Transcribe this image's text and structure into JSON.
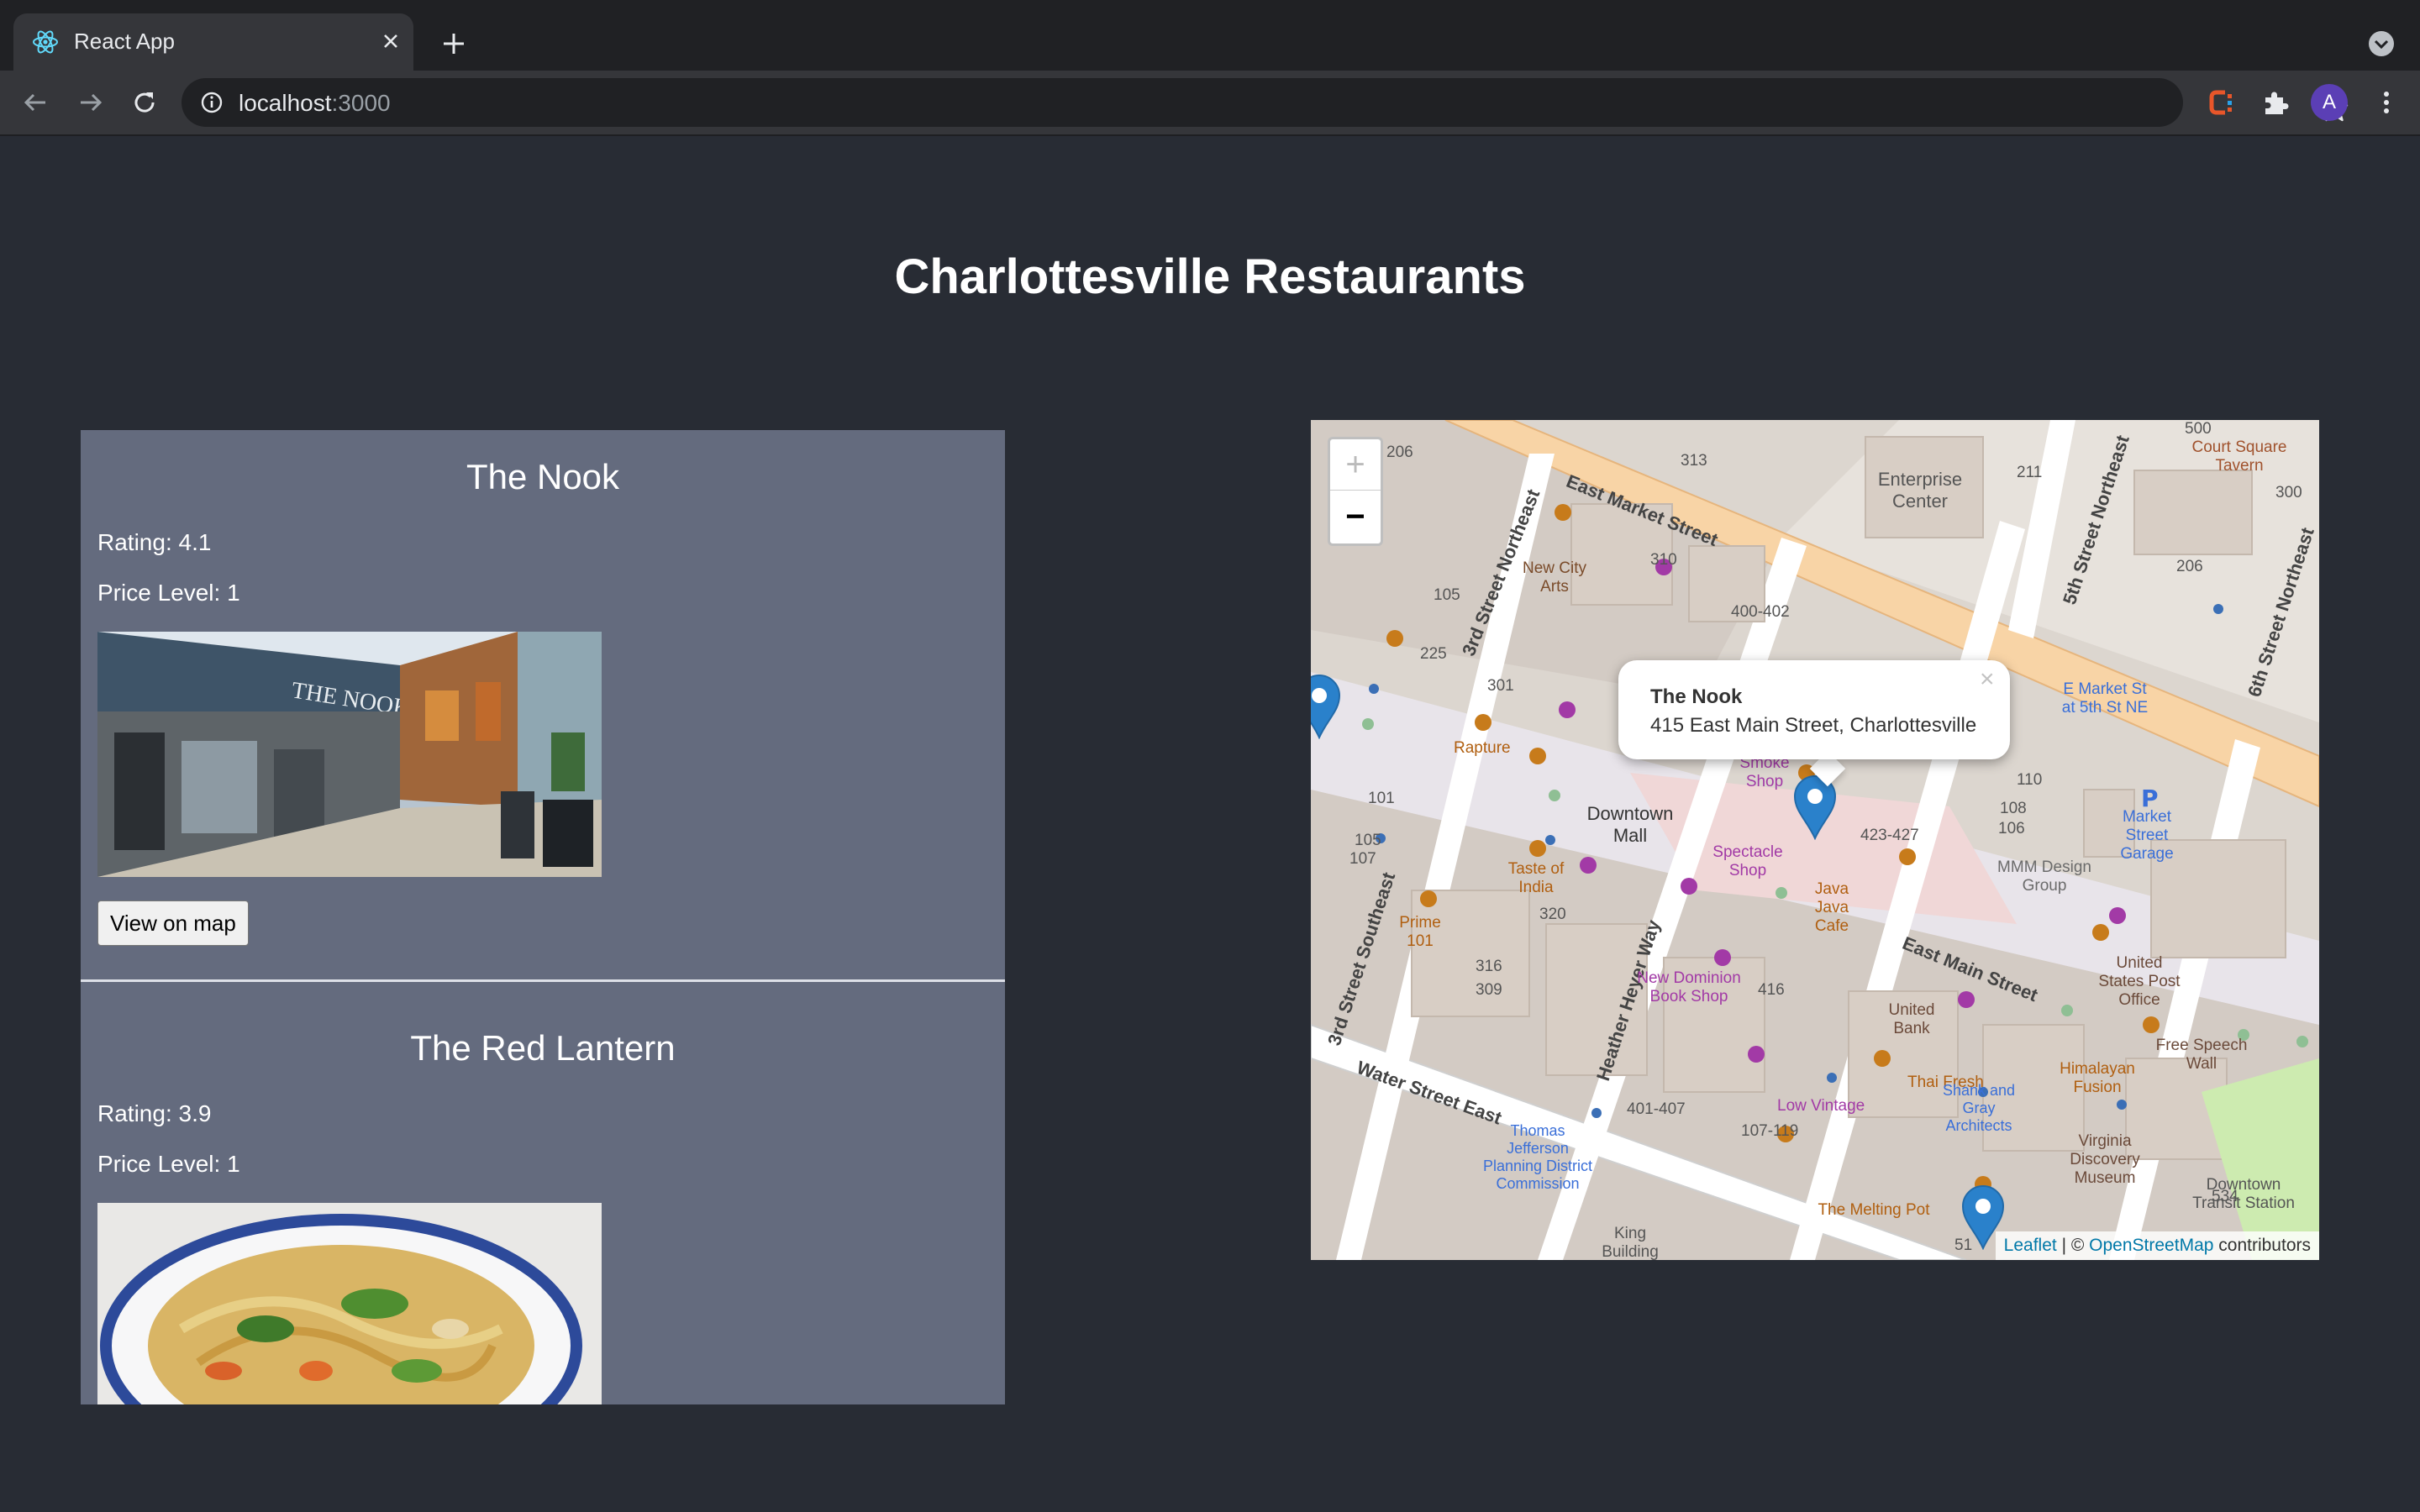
{
  "browser": {
    "tab_title": "React App",
    "url_host": "localhost",
    "url_port": ":3000",
    "avatar_letter": "A"
  },
  "page": {
    "title": "Charlottesville Restaurants"
  },
  "restaurants": [
    {
      "name": "The Nook",
      "rating": "Rating: 4.1",
      "price": "Price Level: 1",
      "button": "View on map"
    },
    {
      "name": "The Red Lantern",
      "rating": "Rating: 3.9",
      "price": "Price Level: 1"
    }
  ],
  "map": {
    "zoom_in": "+",
    "zoom_out": "−",
    "popup": {
      "name": "The Nook",
      "address": "415 East Main Street, Charlottesville",
      "close": "×"
    },
    "attribution": {
      "leaflet": "Leaflet",
      "separator": " | © ",
      "osm": "OpenStreetMap",
      "suffix": " contributors"
    },
    "streets": {
      "east_market": "East Market Street",
      "east_main": "East Main Street",
      "water_street": "Water Street East",
      "third_ne": "3rd Street Northeast",
      "third_se": "3rd Street Southeast",
      "fifth_ne": "5th Street Northeast",
      "sixth_ne": "6th Street Northeast",
      "heather_hoyer": "Heather Heyer Way"
    },
    "labels": {
      "enterprise": "Enterprise Center",
      "court_square": "Court Square Tavern",
      "downtown_mall": "Downtown Mall",
      "new_city_arts": "New City Arts",
      "rapture": "Rapture",
      "taste_of_india": "Taste of India",
      "prime_101": "Prime 101",
      "spectacle": "Spectacle Shop",
      "java_java": "Java Java Cafe",
      "mmm_design": "MMM Design Group",
      "market_garage": "Market Street Garage",
      "e_market_5th": "E Market St at 5th St NE",
      "new_dominion": "New Dominion Book Shop",
      "united_bank": "United Bank",
      "usps": "United States Post Office",
      "free_speech": "Free Speech Wall",
      "himalayan": "Himalayan Fusion",
      "thai_fresh": "Thai Fresh",
      "low_vintage": "Low Vintage",
      "shank": "Shank and Gray Architects",
      "virginia_discovery": "Virginia Discovery Museum",
      "downtown_transit": "Downtown Transit Station",
      "melting_pot": "The Melting Pot",
      "thomas_jefferson": "Thomas Jefferson Planning District Commission",
      "king_building": "King Building",
      "smoke_shop": "Smoke Shop"
    },
    "numbers": [
      "206",
      "313",
      "211",
      "500",
      "300",
      "206",
      "310",
      "400-402",
      "105",
      "225",
      "301",
      "101",
      "105",
      "107",
      "320",
      "316",
      "309",
      "416",
      "401-407",
      "107-119",
      "110",
      "108",
      "106",
      "423-427",
      "534",
      "51"
    ]
  }
}
